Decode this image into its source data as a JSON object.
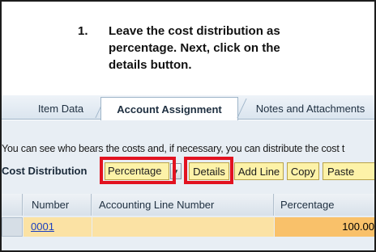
{
  "instruction": {
    "step_number": "1.",
    "text": "Leave the cost distribution as percentage. Next, click on the details button."
  },
  "tabs": [
    {
      "label": "Item Data",
      "active": false
    },
    {
      "label": "Account Assignment",
      "active": true
    },
    {
      "label": "Notes and Attachments",
      "active": false
    }
  ],
  "info_text": "You can see who bears the costs and, if necessary, you can distribute the cost t",
  "cost_distribution": {
    "label": "Cost Distribution",
    "selected": "Percentage"
  },
  "toolbar": {
    "details_label": "Details",
    "add_line_label": "Add Line",
    "copy_label": "Copy",
    "paste_label": "Paste"
  },
  "table": {
    "headers": [
      "Number",
      "Accounting Line Number",
      "Percentage"
    ],
    "rows": [
      {
        "number": "0001",
        "accounting_line_number": "",
        "percentage": "100.00"
      }
    ]
  },
  "colors": {
    "highlight": "#e21220",
    "button_yellow": "#fdf2a8",
    "row_fill": "#fbe2a4",
    "percentage_fill": "#f9c16a",
    "link_blue": "#1a3fc0"
  },
  "icons": {
    "dropdown": "chevron-down-icon"
  }
}
